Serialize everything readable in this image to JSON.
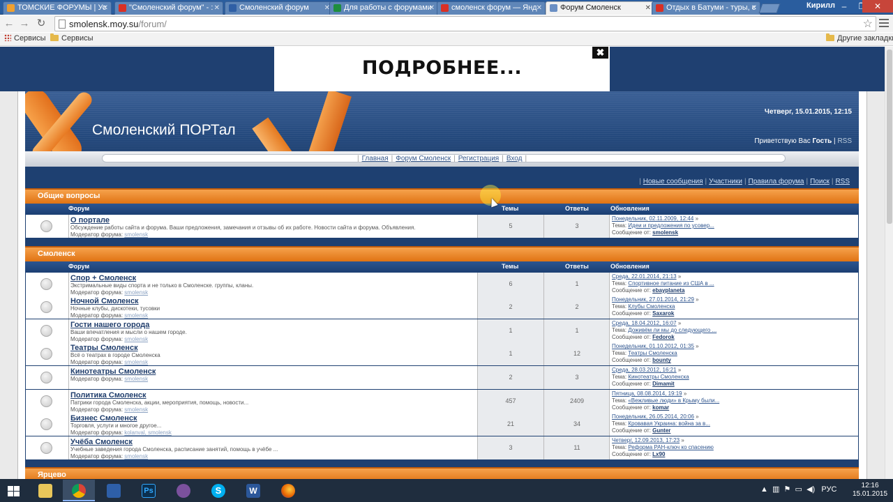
{
  "browser": {
    "tabs": [
      {
        "label": "ТОМСКИЕ ФОРУМЫ | Ус",
        "color": "#f0a030"
      },
      {
        "label": "\"Смоленский форум\" - :",
        "color": "#d93025"
      },
      {
        "label": "Смоленский форум",
        "color": "#2f5fa5"
      },
      {
        "label": "Для работы с форумами",
        "color": "#1e8e3e"
      },
      {
        "label": "смоленск форум — Янд",
        "color": "#d93025"
      },
      {
        "label": "Форум Смоленск",
        "color": "#6a8fc4"
      },
      {
        "label": "Отдых в Батуми - туры, с",
        "color": "#d93025"
      }
    ],
    "user": "Кирилл",
    "url_host": "smolensk.moy.su",
    "url_path": "/forum/",
    "bookmarks": {
      "services1": "Сервисы",
      "services2": "Сервисы",
      "other": "Другие закладки"
    }
  },
  "ad": {
    "text": "ПОДРОБНЕЕ...",
    "close": "✖"
  },
  "header": {
    "site_title": "Смоленский ПОРТал",
    "date": "Четверг, 15.01.2015, 12:15",
    "greet_prefix": "Приветствую Вас",
    "greet_user": "Гость",
    "rss": "RSS",
    "nav": [
      "Главная",
      "Форум Смоленск",
      "Регистрация",
      "Вход"
    ],
    "quick": [
      "Новые сообщения",
      "Участники",
      "Правила форума",
      "Поиск",
      "RSS"
    ]
  },
  "columns": {
    "forum": "Форум",
    "topics": "Темы",
    "replies": "Ответы",
    "updates": "Обновления"
  },
  "labels": {
    "moderator": "Модератор форума:",
    "theme": "Тема:",
    "msg_from": "Сообщение от:"
  },
  "categories": [
    {
      "name": "Общие вопросы",
      "forums": [
        {
          "title": "О портале",
          "desc": "Обсуждение работы сайта и форума. Ваши предложения, замечания и отзывы об их работе. Новости сайта и форума. Объявления.",
          "mods": "smolensk",
          "topics": "5",
          "replies": "3",
          "date": "Понедельник, 02.11.2009, 12:44",
          "theme": "Идеи и предложения по усовер...",
          "author": "smolensk"
        }
      ]
    },
    {
      "name": "Смоленск",
      "forums": [
        {
          "title": "Спор + Смоленск",
          "desc": "Экстримальные виды спорта и не только в Смоленске. группы, кланы.",
          "mods": "smolensk",
          "topics": "6",
          "replies": "1",
          "date": "Среда, 22.01.2014, 21:13",
          "theme": "Спортивное питание из США в ...",
          "author": "ebayplaneta"
        },
        {
          "title": "Ночной Смоленск",
          "desc": "Ночные клубы, дискотеки, тусовки",
          "mods": "smolensk",
          "topics": "2",
          "replies": "2",
          "date": "Понедельник, 27.01.2014, 21:29",
          "theme": "Клубы Смоленска",
          "author": "Saxarok"
        },
        {
          "title": "Гости нашего города",
          "desc": "Ваши впечатления и мысли о нашем городе.",
          "mods": "smolensk",
          "topics": "1",
          "replies": "1",
          "date": "Среда, 18.04.2012, 16:07",
          "theme": "Доживём ли мы до следующего ...",
          "author": "Fedorok"
        },
        {
          "title": "Театры Смоленск",
          "desc": "Всё о театрах в городе Смоленска",
          "mods": "smolensk",
          "topics": "1",
          "replies": "12",
          "date": "Понедельник, 01.10.2012, 01:35",
          "theme": "Театры Смоленска",
          "author": "bounty"
        },
        {
          "title": "Кинотеатры Смоленск",
          "desc": "",
          "mods": "smolensk",
          "topics": "2",
          "replies": "3",
          "date": "Среда, 28.03.2012, 16:21",
          "theme": "Кинотеатры Смоленска",
          "author": "Dimamit"
        },
        {
          "title": "Политика Смоленск",
          "desc": "Патрики города Смоленска, акции, мероприятия, помощь, новости...",
          "mods": "smolensk",
          "topics": "457",
          "replies": "2409",
          "date": "Пятница, 08.08.2014, 19:19",
          "theme": "«Вежливые люди» в Крыму были...",
          "author": "komar"
        },
        {
          "title": "Бизнес Смоленск",
          "desc": "Торговля, услуги и многое другое...",
          "mods": "kolanval, smolensk",
          "topics": "21",
          "replies": "34",
          "date": "Понедельник, 26.05.2014, 20:06",
          "theme": "Кровавая Украина: война за в...",
          "author": "Gunter"
        },
        {
          "title": "Учёба Смоленск",
          "desc": "Учебные заведения города Смоленска, расписание занятий, помощь в учёбе ...",
          "mods": "smolensk",
          "topics": "3",
          "replies": "11",
          "date": "Четверг, 12.09.2013, 17:23",
          "theme": "Реформа РАН-ключ ко спасению",
          "author": "Lx90"
        }
      ]
    },
    {
      "name": "Ярцево",
      "forums": []
    }
  ],
  "taskbar": {
    "lang": "РУС",
    "time": "12:16",
    "date": "15.01.2015"
  }
}
